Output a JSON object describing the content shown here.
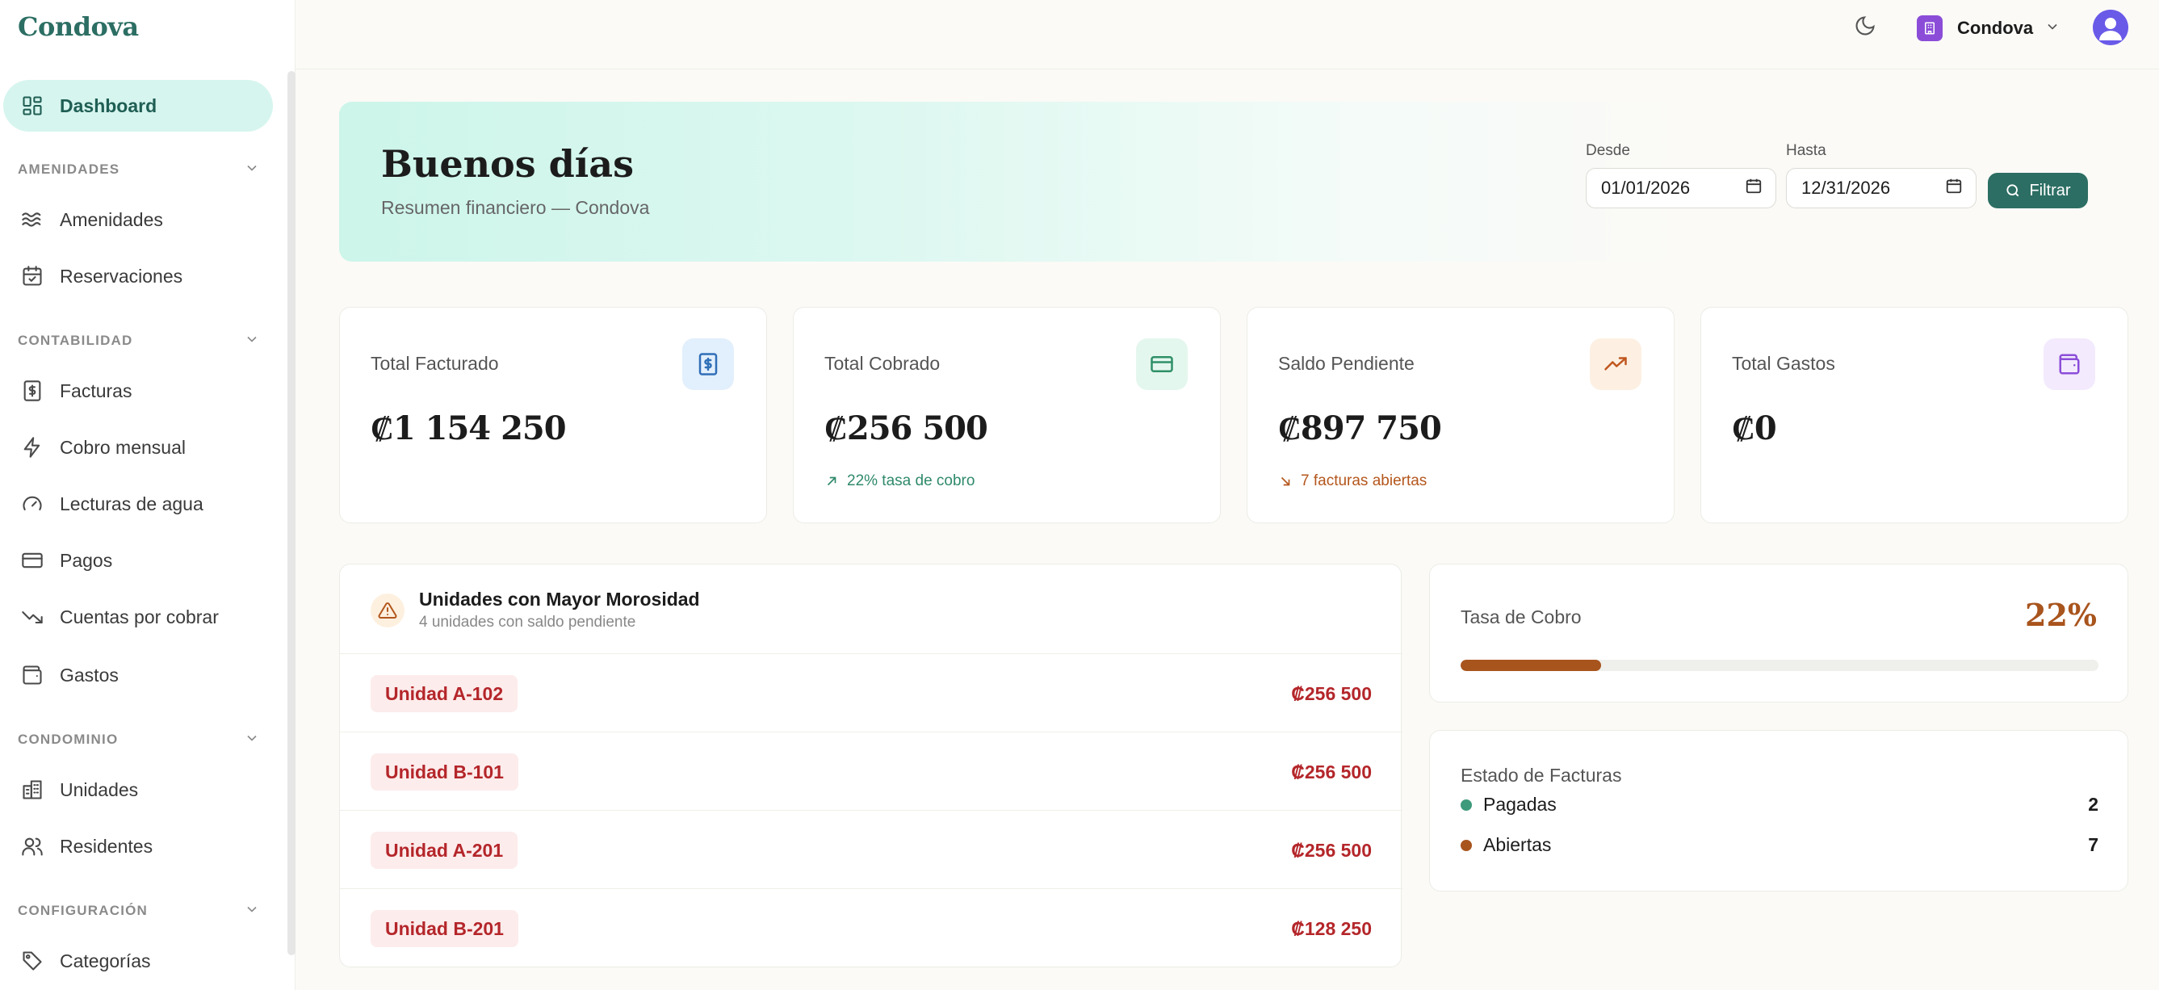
{
  "app": {
    "brand": "Condova"
  },
  "topbar": {
    "org_name": "Condova"
  },
  "sidebar": {
    "dashboard": "Dashboard",
    "sections": [
      {
        "title": "AMENIDADES",
        "items": [
          "Amenidades",
          "Reservaciones"
        ]
      },
      {
        "title": "CONTABILIDAD",
        "items": [
          "Facturas",
          "Cobro mensual",
          "Lecturas de agua",
          "Pagos",
          "Cuentas por cobrar",
          "Gastos"
        ]
      },
      {
        "title": "CONDOMINIO",
        "items": [
          "Unidades",
          "Residentes"
        ]
      },
      {
        "title": "CONFIGURACIÓN",
        "items": [
          "Categorías"
        ]
      }
    ]
  },
  "hero": {
    "title": "Buenos días",
    "subtitle": "Resumen financiero — Condova",
    "from_label": "Desde",
    "from_value": "01/01/2026",
    "to_label": "Hasta",
    "to_value": "12/31/2026",
    "filter_label": "Filtrar"
  },
  "stats": [
    {
      "label": "Total Facturado",
      "value": "₡1 154 250",
      "note": ""
    },
    {
      "label": "Total Cobrado",
      "value": "₡256 500",
      "note": "22% tasa de cobro"
    },
    {
      "label": "Saldo Pendiente",
      "value": "₡897 750",
      "note": "7 facturas abiertas"
    },
    {
      "label": "Total Gastos",
      "value": "₡0",
      "note": ""
    }
  ],
  "delinquent": {
    "title": "Unidades con Mayor Morosidad",
    "subtitle": "4 unidades con saldo pendiente",
    "rows": [
      {
        "unit": "Unidad A-102",
        "amount": "₡256 500"
      },
      {
        "unit": "Unidad B-101",
        "amount": "₡256 500"
      },
      {
        "unit": "Unidad A-201",
        "amount": "₡256 500"
      },
      {
        "unit": "Unidad B-201",
        "amount": "₡128 250"
      }
    ]
  },
  "collection_rate": {
    "label": "Tasa de Cobro",
    "value_text": "22%",
    "fraction": 0.22,
    "color": "#a8541d"
  },
  "invoice_status": {
    "title": "Estado de Facturas",
    "items": [
      {
        "label": "Pagadas",
        "count": "2",
        "color": "#3d9a7a"
      },
      {
        "label": "Abiertas",
        "count": "7",
        "color": "#a8541d"
      }
    ]
  },
  "colors": {
    "brand": "#2c6e63",
    "active_bg": "#d6f5ee",
    "danger": "#b4262a",
    "warning": "#a8541d",
    "accent_purple": "#8b4dd8"
  },
  "icons": {
    "nav": [
      "dashboard-icon",
      "waves-icon",
      "calendar-check-icon",
      "invoice-icon",
      "zap-icon",
      "gauge-icon",
      "credit-card-icon",
      "trend-down-icon",
      "wallet-icon",
      "building-icon",
      "users-icon",
      "tag-icon"
    ],
    "stats": [
      "invoice-icon",
      "credit-card-icon",
      "trend-up-icon",
      "wallet-icon"
    ]
  }
}
